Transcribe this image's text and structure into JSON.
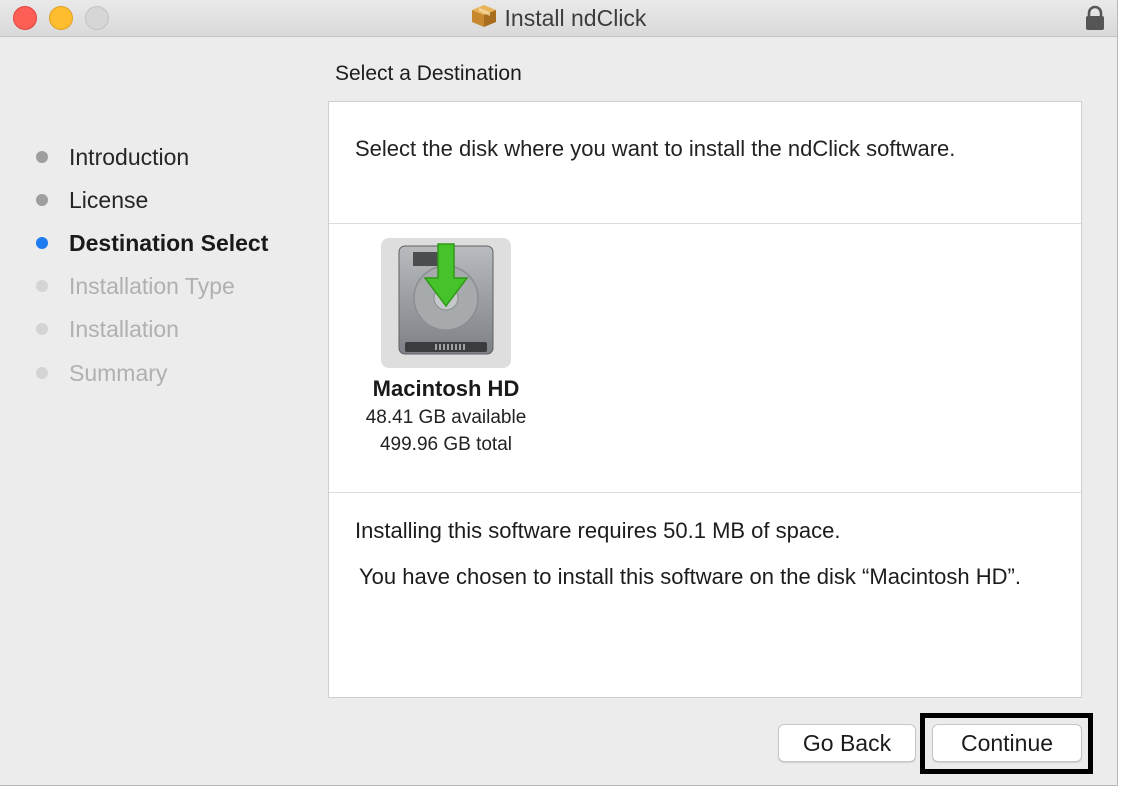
{
  "window": {
    "title": "Install ndClick"
  },
  "sidebar": {
    "steps": [
      {
        "label": "Introduction",
        "state": "done"
      },
      {
        "label": "License",
        "state": "done"
      },
      {
        "label": "Destination Select",
        "state": "current"
      },
      {
        "label": "Installation Type",
        "state": "future"
      },
      {
        "label": "Installation",
        "state": "future"
      },
      {
        "label": "Summary",
        "state": "future"
      }
    ]
  },
  "main": {
    "heading": "Select a Destination",
    "intro": "Select the disk where you want to install the ndClick software.",
    "disk": {
      "name": "Macintosh HD",
      "available": "48.41 GB available",
      "total": "499.96 GB total",
      "icon": "hard-disk-icon"
    },
    "requires": "Installing this software requires 50.1 MB of space.",
    "chosen": "You have chosen to install this software on the disk “Macintosh HD”."
  },
  "buttons": {
    "go_back": "Go Back",
    "continue": "Continue"
  },
  "colors": {
    "accent": "#1f7bf1",
    "close": "#fd5f57",
    "minimize": "#fdbd2e",
    "arrow": "#46c22a"
  }
}
